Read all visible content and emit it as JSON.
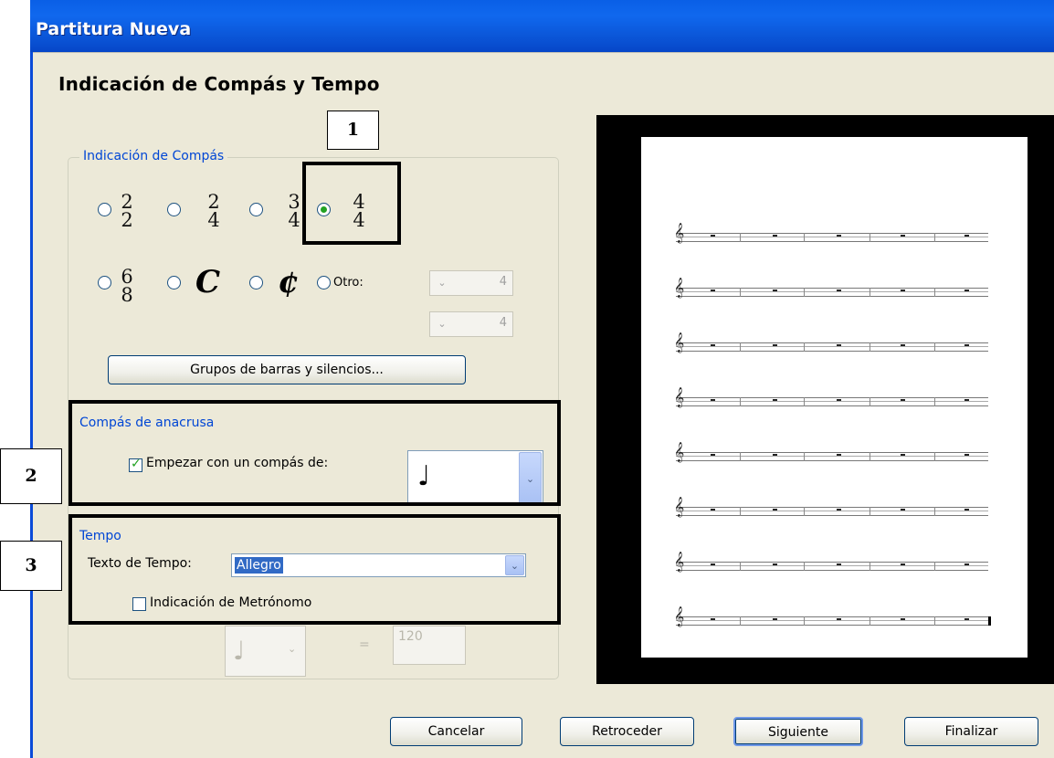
{
  "window": {
    "title": "Partitura Nueva"
  },
  "page": {
    "title": "Indicación de Compás y Tempo"
  },
  "time_signature": {
    "group_label": "Indicación de Compás",
    "options": [
      {
        "top": "2",
        "bottom": "2",
        "selected": false
      },
      {
        "top": "2",
        "bottom": "4",
        "selected": false
      },
      {
        "top": "3",
        "bottom": "4",
        "selected": false
      },
      {
        "top": "4",
        "bottom": "4",
        "selected": true
      },
      {
        "top": "6",
        "bottom": "8",
        "selected": false
      },
      {
        "symbol": "C",
        "selected": false
      },
      {
        "symbol": "¢",
        "selected": false
      }
    ],
    "other_label": "Otro:",
    "other_top_value": "4",
    "other_bottom_value": "4",
    "beam_groups_button": "Grupos de barras y silencios..."
  },
  "pickup": {
    "group_label": "Compás de anacrusa",
    "checkbox_label": "Empezar con un compás de:",
    "checked": true,
    "note_value": "♩"
  },
  "tempo": {
    "group_label": "Tempo",
    "text_label": "Texto de Tempo:",
    "text_value": "Allegro",
    "metronome_label": "Indicación de Metrónomo",
    "metronome_checked": false,
    "metronome_note": "♩",
    "equals": "=",
    "bpm": "120"
  },
  "annotations": {
    "one": "1",
    "two": "2",
    "three": "3"
  },
  "buttons": {
    "cancel": "Cancelar",
    "back": "Retroceder",
    "next": "Siguiente",
    "finish": "Finalizar"
  },
  "preview": {
    "staff_count": 8,
    "clef": "𝄞"
  }
}
